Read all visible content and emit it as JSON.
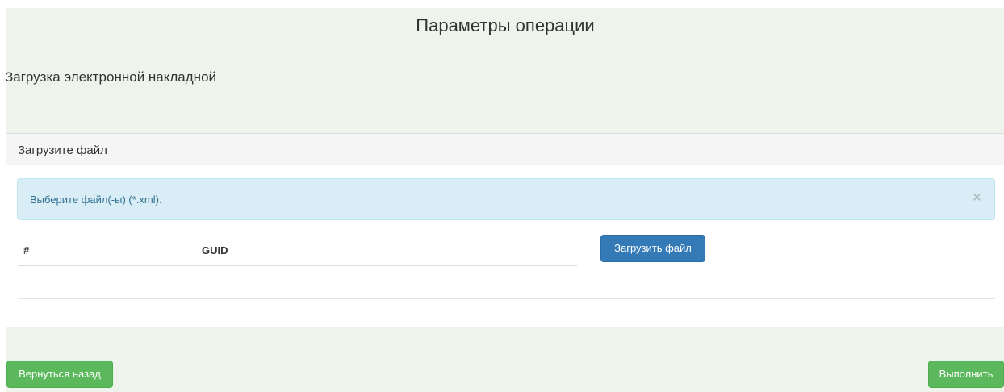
{
  "page": {
    "title": "Параметры операции",
    "subtitle": "Загрузка электронной накладной"
  },
  "panel": {
    "heading": "Загрузите файл",
    "alert": {
      "text": "Выберите файл(-ы) (*.xml).",
      "close_icon": "×"
    },
    "table": {
      "columns": [
        "#",
        "GUID"
      ],
      "rows": []
    },
    "upload_button_label": "Загрузить файл"
  },
  "footer": {
    "back_button_label": "Вернуться назад",
    "run_button_label": "Выполнить"
  },
  "colors": {
    "page_background": "#eef3ec",
    "primary": "#337ab7",
    "success": "#5cb85c",
    "alert_info_bg": "#d9edf7",
    "alert_info_text": "#31708f"
  }
}
